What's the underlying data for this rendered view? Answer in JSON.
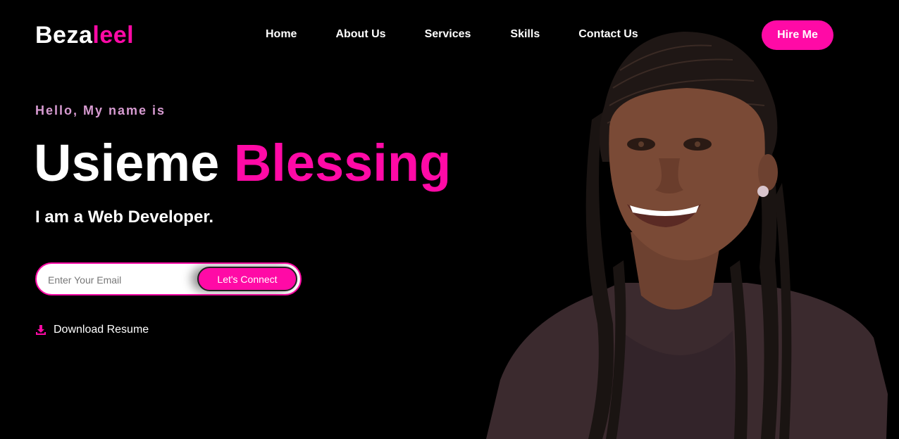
{
  "header": {
    "logo_part1": "Beza",
    "logo_part2": "leel",
    "nav": {
      "home": "Home",
      "about": "About Us",
      "services": "Services",
      "skills": "Skills",
      "contact": "Contact Us"
    },
    "hire_button": "Hire Me"
  },
  "hero": {
    "greeting": "Hello, My name is",
    "first_name": "Usieme",
    "last_name": "Blessing",
    "role": "I am a Web Developer.",
    "email_placeholder": "Enter Your Email",
    "connect_button": "Let's Connect",
    "download_label": "Download Resume"
  },
  "icons": {
    "download": "download-icon"
  },
  "colors": {
    "background": "#000000",
    "accent": "#ff0aa6",
    "greeting": "#d79bd1",
    "text": "#ffffff"
  }
}
